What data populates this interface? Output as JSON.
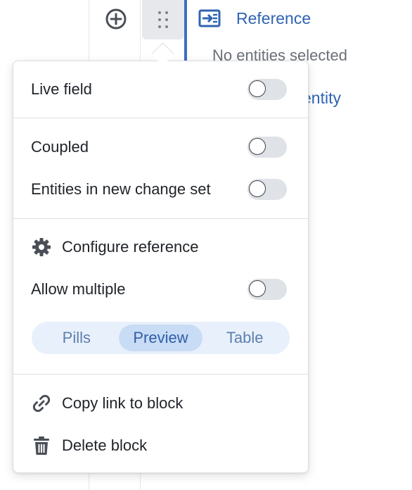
{
  "reference_block": {
    "title": "Reference",
    "empty_text": "No entities selected",
    "entity_link_fragment": "entity"
  },
  "menu": {
    "live_field": {
      "label": "Live field",
      "enabled": false
    },
    "coupled": {
      "label": "Coupled",
      "enabled": false
    },
    "new_change_set": {
      "label": "Entities in new change set",
      "enabled": false
    },
    "configure": {
      "label": "Configure reference",
      "icon": "gear-icon"
    },
    "allow_multiple": {
      "label": "Allow multiple",
      "enabled": false
    },
    "display_modes": {
      "options": [
        "Pills",
        "Preview",
        "Table"
      ],
      "selected": "Preview"
    },
    "copy_link": {
      "label": "Copy link to block",
      "icon": "link-icon"
    },
    "delete": {
      "label": "Delete block",
      "icon": "trash-icon"
    }
  },
  "colors": {
    "accent": "#2f64b3",
    "segment_bg": "#e8f0fb",
    "segment_active": "#c9dcf6",
    "toggle_off": "#dfe2e6"
  }
}
